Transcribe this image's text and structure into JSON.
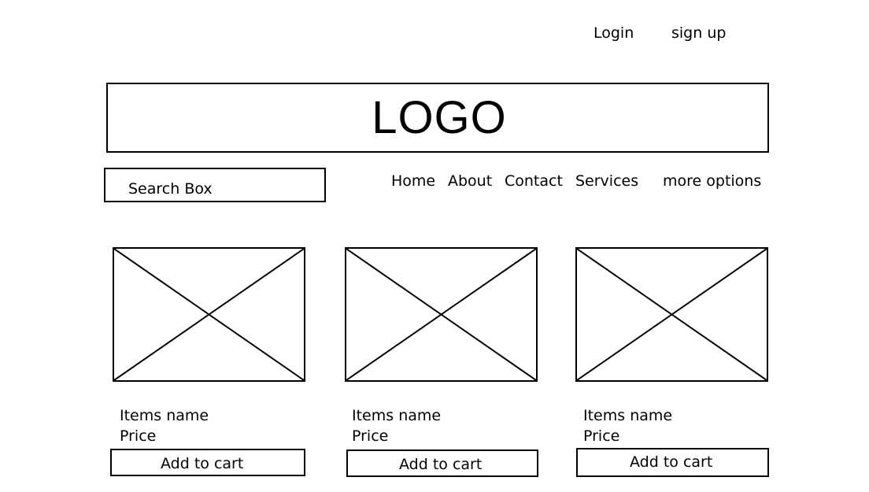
{
  "header": {
    "login_label": "Login",
    "signup_label": "sign up",
    "logo_text": "LOGO"
  },
  "search": {
    "label": "Search Box"
  },
  "nav": {
    "items": [
      {
        "label": "Home"
      },
      {
        "label": "About"
      },
      {
        "label": "Contact"
      },
      {
        "label": "Services"
      },
      {
        "label": "more options"
      }
    ]
  },
  "products": [
    {
      "image_icon": "image-placeholder-icon",
      "name": "Items name",
      "price": "Price",
      "button_label": "Add to cart"
    },
    {
      "image_icon": "image-placeholder-icon",
      "name": "Items name",
      "price": "Price",
      "button_label": "Add to cart"
    },
    {
      "image_icon": "image-placeholder-icon",
      "name": "Items name",
      "price": "Price",
      "button_label": "Add to cart"
    }
  ],
  "colors": {
    "stroke": "#000000",
    "background": "#ffffff"
  }
}
